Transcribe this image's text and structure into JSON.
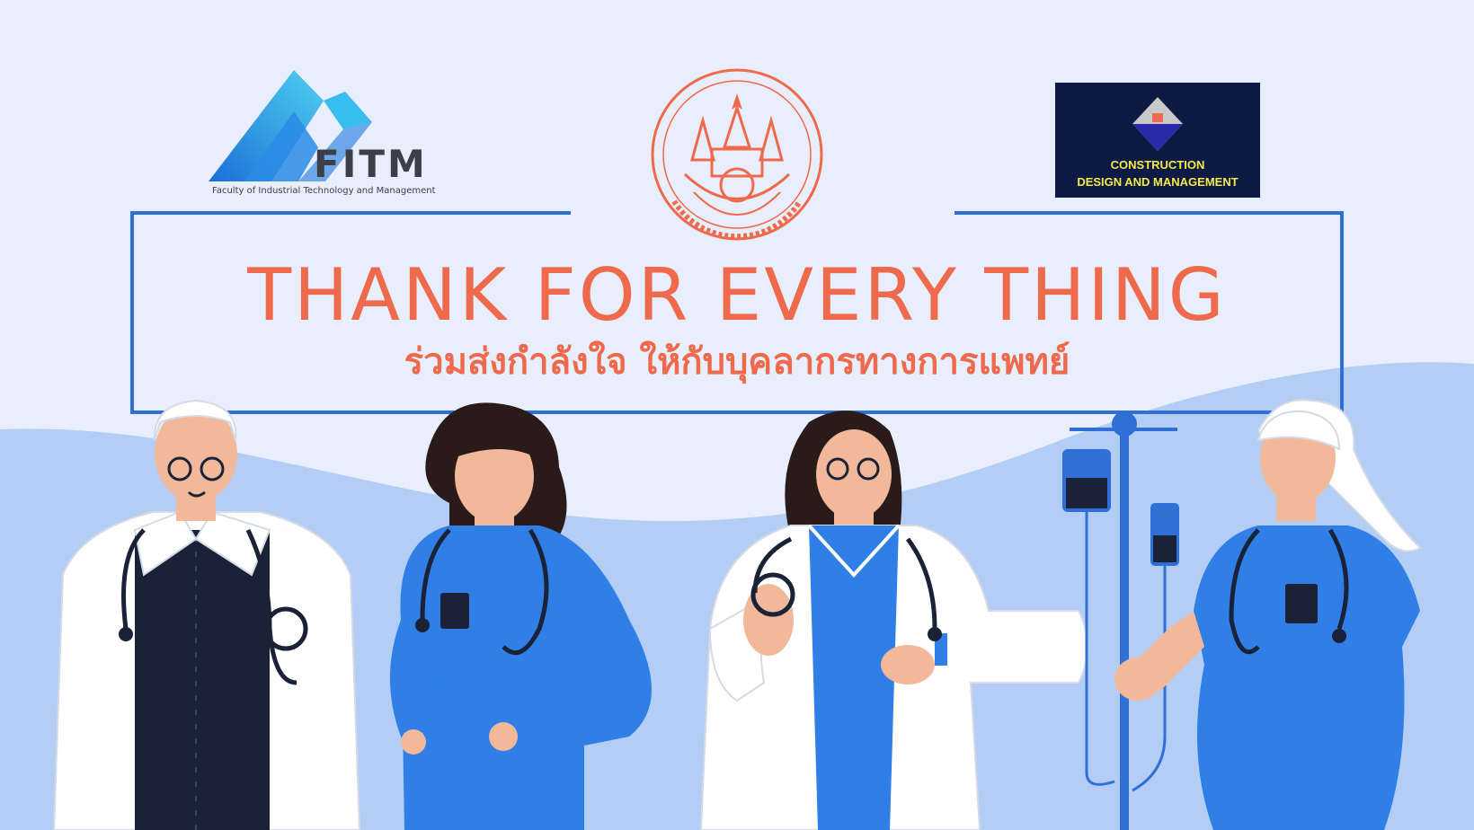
{
  "logos": {
    "fitm": {
      "wordmark": "FITM",
      "subtitle": "Faculty of Industrial Technology and Management"
    },
    "seal": {
      "icon": "university-seal-icon",
      "color": "#ef6a4c"
    },
    "cdm": {
      "line1": "CONSTRUCTION",
      "line2": "DESIGN AND MANAGEMENT"
    }
  },
  "banner": {
    "headline": "THANK FOR EVERY THING",
    "subline": "ร่วมส่งกำลังใจ ให้กับบุคลากรทางการแพทย์"
  },
  "illustration": {
    "figures": [
      "doctor-elderly-man",
      "nurse-woman-hands-on-hips",
      "doctor-woman-checking-watch",
      "iv-drip-stand",
      "nurse-elderly-woman"
    ]
  },
  "colors": {
    "accent_blue": "#2f6fd6",
    "headline_orange": "#ef6a4c",
    "background": "#e8eefb",
    "wave": "#b4cdf5"
  }
}
